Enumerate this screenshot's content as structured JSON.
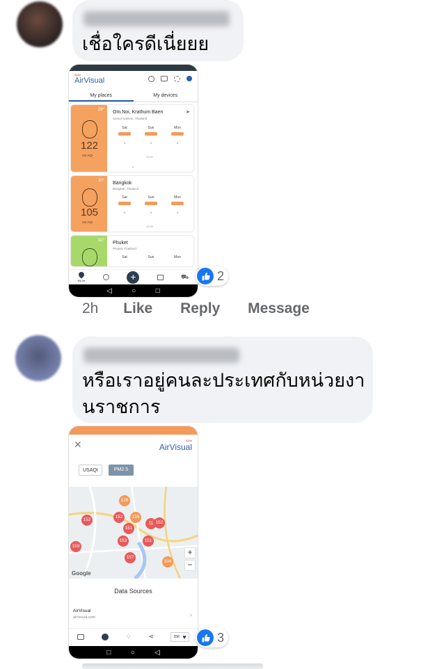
{
  "comments": [
    {
      "text": "เชื่อใครดีเนี่ยยย",
      "time": "2h",
      "actions": [
        "Like",
        "Reply",
        "Message"
      ],
      "reactions": "2",
      "screenshot": {
        "app_logo_top": "IQAir",
        "app_logo": "AirVisual",
        "tabs": [
          "My places",
          "My devices"
        ],
        "cards": [
          {
            "city": "Om Noi, Krathum Baen",
            "region": "Samut Sakhon, Thailand",
            "aqi": "122",
            "unit": "US AQI",
            "temp": "29°",
            "color": "#f5a15f",
            "days": [
              "Sat",
              "Sun",
              "Mon"
            ],
            "time": "11:00"
          },
          {
            "city": "Bangkok",
            "region": "Bangkok, Thailand",
            "aqi": "105",
            "unit": "US AQI",
            "temp": "30°",
            "color": "#f5a15f",
            "days": [
              "Sat",
              "Sun",
              "Mon"
            ],
            "time": "12:00"
          },
          {
            "city": "Phuket",
            "region": "Phuket, Thailand",
            "temp": "32°",
            "color": "#a8d86a",
            "days": [
              "Sat",
              "Sun",
              "Mon"
            ]
          }
        ],
        "bottom_tab_label": "My Air"
      }
    },
    {
      "text_line1": "หรือเราอยู่คนละประเทศกับหน่วยงา",
      "text_line2": "นราชการ",
      "reactions": "3",
      "screenshot": {
        "app_logo_top": "IQAir",
        "app_logo": "AirVisual",
        "chips": [
          "USAQI",
          "PM2.5"
        ],
        "markers": [
          {
            "label": "152",
            "color": "#e85a5a"
          },
          {
            "label": "152",
            "color": "#e85a5a"
          },
          {
            "label": "139",
            "color": "#f39a5a"
          },
          {
            "label": "151",
            "color": "#e85a5a"
          },
          {
            "label": "152",
            "color": "#e85a5a"
          },
          {
            "label": "11",
            "color": "#e85a5a"
          },
          {
            "label": "153",
            "color": "#e85a5a"
          },
          {
            "label": "151",
            "color": "#e85a5a"
          },
          {
            "label": "153",
            "color": "#e85a5a"
          },
          {
            "label": "157",
            "color": "#e85a5a"
          },
          {
            "label": "104",
            "color": "#f39a5a"
          },
          {
            "label": "126",
            "color": "#f39a5a"
          }
        ],
        "map_brand": "Google",
        "section_title": "Data Sources",
        "source_name": "AirVisual",
        "source_url": "airvisual.com",
        "likes": "25K"
      }
    }
  ]
}
